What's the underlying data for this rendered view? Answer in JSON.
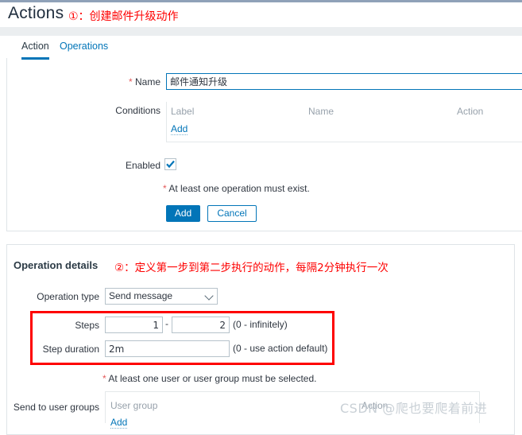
{
  "page": {
    "title": "Actions",
    "annotation_1": "①：创建邮件升级动作",
    "annotation_2": "②：定义第一步到第二步执行的动作，每隔2分钟执行一次",
    "watermark": "CSDN @爬也要爬着前进"
  },
  "tabs": [
    {
      "label": "Action",
      "active": true
    },
    {
      "label": "Operations",
      "active": false
    }
  ],
  "action_form": {
    "name_label": "Name",
    "name_required_mark": "*",
    "name_value": "邮件通知升级",
    "conditions_label": "Conditions",
    "conditions_columns": [
      "Label",
      "Name",
      "Action"
    ],
    "conditions_add_link": "Add",
    "enabled_label": "Enabled",
    "enabled_checked": true,
    "operation_note": "* At least one operation must exist.",
    "operation_note_mark": "*",
    "operation_note_text": "At least one operation must exist.",
    "add_button": "Add",
    "cancel_button": "Cancel"
  },
  "operation_details": {
    "title": "Operation details",
    "operation_type_label": "Operation type",
    "operation_type_value": "Send message",
    "steps_label": "Steps",
    "steps_from": "1",
    "steps_separator": "-",
    "steps_to": "2",
    "steps_hint": "(0 - infinitely)",
    "step_duration_label": "Step duration",
    "step_duration_value": "2m",
    "step_duration_hint": "(0 - use action default)",
    "user_note_mark": "*",
    "user_note_text": "At least one user or user group must be selected.",
    "send_to_label": "Send to user groups",
    "user_group_columns": [
      "User group",
      "Action"
    ],
    "user_group_add_link": "Add"
  },
  "colors": {
    "accent": "#0275b8",
    "annotation_red": "#fe0000",
    "required_red": "#e45959",
    "muted_text": "#97a1ab"
  }
}
